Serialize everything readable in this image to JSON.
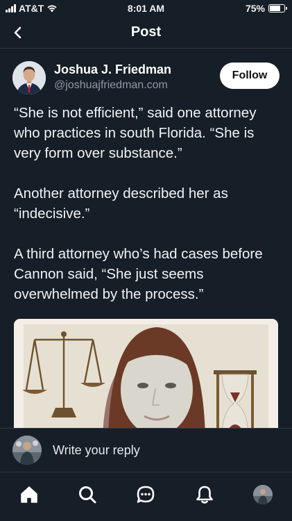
{
  "status_bar": {
    "carrier": "AT&T",
    "time": "8:01 AM",
    "battery": "75%",
    "battery_level": 0.75
  },
  "header": {
    "title": "Post",
    "back_icon": "chevron-left-icon"
  },
  "post": {
    "author": {
      "name": "Joshua J. Friedman",
      "handle": "@joshuajfriedman.com"
    },
    "follow_label": "Follow",
    "paragraphs": [
      "“She is not efficient,” said one attorney who practices in south Florida. “She is very form over substance.”",
      "Another attorney described her as “indecisive.”",
      "A third attorney who’s had cases before Cannon said, “She just seems overwhelmed by the process.”"
    ]
  },
  "reply": {
    "placeholder": "Write your reply"
  },
  "tab_bar": {
    "items": [
      "home-icon",
      "search-icon",
      "chat-icon",
      "bell-icon",
      "profile-avatar"
    ]
  },
  "colors": {
    "background": "#161e27",
    "divider": "#2e3844",
    "text": "#f1f3f5",
    "muted": "#8e9aa6"
  }
}
